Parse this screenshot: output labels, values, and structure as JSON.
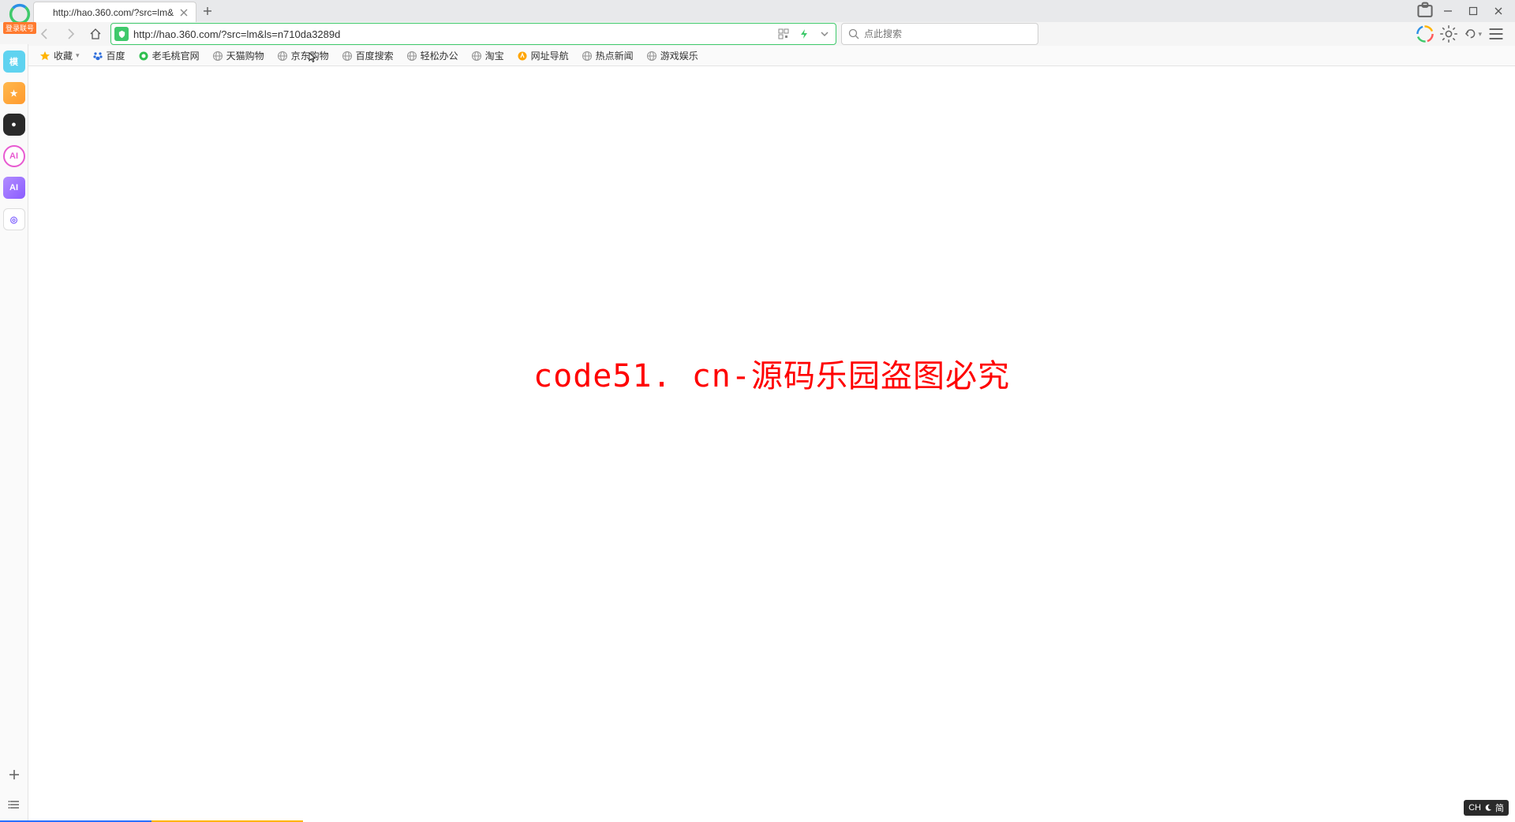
{
  "tab": {
    "title": "http://hao.360.com/?src=lm&"
  },
  "logo_badge": "登录联号",
  "nav": {
    "url": "http://hao.360.com/?src=lm&ls=n710da3289d",
    "search_placeholder": "点此搜索"
  },
  "bookmarks": {
    "favorites": "收藏",
    "items": [
      {
        "label": "百度",
        "icon": "paw"
      },
      {
        "label": "老毛桃官网",
        "icon": "green-dot"
      },
      {
        "label": "天猫购物",
        "icon": "globe"
      },
      {
        "label": "京东购物",
        "icon": "globe"
      },
      {
        "label": "百度搜索",
        "icon": "globe"
      },
      {
        "label": "轻松办公",
        "icon": "globe"
      },
      {
        "label": "淘宝",
        "icon": "globe"
      },
      {
        "label": "网址导航",
        "icon": "orange-dot"
      },
      {
        "label": "热点新闻",
        "icon": "globe"
      },
      {
        "label": "游戏娱乐",
        "icon": "globe"
      }
    ]
  },
  "sidebar": {
    "items": [
      "模",
      "★",
      "●",
      "AI",
      "AI",
      "◎"
    ]
  },
  "content": {
    "watermark": "code51. cn-源码乐园盗图必究"
  },
  "ime": {
    "lang": "CH",
    "mode": "简"
  }
}
